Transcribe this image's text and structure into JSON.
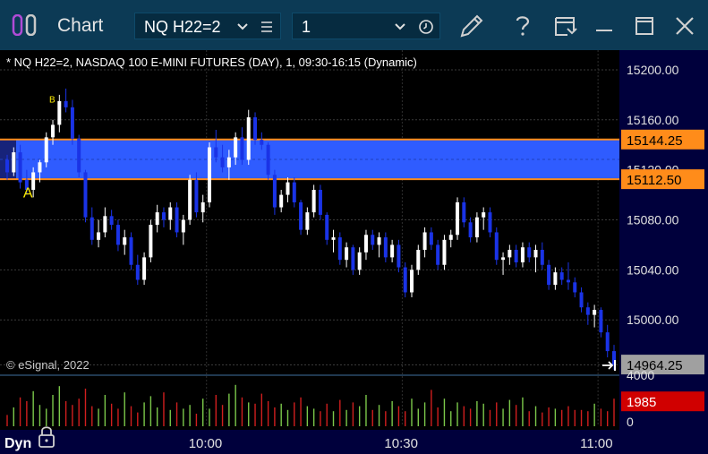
{
  "window": {
    "title": "Chart",
    "symbol": "NQ H22=2",
    "interval": "1",
    "icons": [
      "app-logo-icon",
      "chevron-down-icon",
      "menu-lines-icon",
      "clock-icon",
      "pencil-icon",
      "help-icon",
      "save-template-icon",
      "maximize-icon",
      "close-icon"
    ]
  },
  "colors": {
    "titlebar": "#0c3a55",
    "axis_panel": "#00003c",
    "up_candle": "#ffffff",
    "down_candle": "#1a33e6",
    "band_fill": "#2f5cff",
    "band_border": "#ff8c1a",
    "vol_up": "#7cc84a",
    "vol_down": "#d01e1e",
    "last_price_tag": "#a0a0a0",
    "volume_tag": "#d00000"
  },
  "chart_data": {
    "type": "candlestick",
    "title": "* NQ H22=2, NASDAQ 100 E-MINI FUTURES (DAY), 1, 09:30-16:15 (Dynamic)",
    "copyright": "© eSignal, 2022",
    "y_axis": {
      "range": [
        14950,
        15210
      ],
      "ticks": [
        "15200.00",
        "15160.00",
        "15120.00",
        "15080.00",
        "15040.00",
        "15000.00"
      ],
      "tick_values": [
        15200,
        15160,
        15120,
        15080,
        15040,
        15000
      ]
    },
    "band": {
      "upper": 15144.25,
      "lower": 15112.5,
      "upper_label": "15144.25",
      "lower_label": "15112.50"
    },
    "last_price": {
      "value": 14964.25,
      "label": "14964.25"
    },
    "markers": [
      {
        "label": "B",
        "price": 15174,
        "bar": 7
      },
      {
        "label": "A",
        "price": 15108,
        "bar": 3
      }
    ],
    "x_axis": {
      "ticks": [
        "10:00",
        "10:30",
        "11:00"
      ],
      "tick_bars": [
        30,
        60,
        90
      ],
      "label_mode": "Dyn"
    },
    "volume": {
      "ticks": [
        "4000",
        "0"
      ],
      "range": [
        0,
        4000
      ],
      "last": 1985,
      "last_label": "1985",
      "values": [
        900,
        1500,
        2300,
        2000,
        2800,
        1700,
        1400,
        2500,
        3200,
        2000,
        1700,
        2200,
        3000,
        1600,
        1400,
        2500,
        1800,
        1400,
        2700,
        1600,
        1100,
        1900,
        2400,
        1500,
        2700,
        1300,
        1900,
        1400,
        1700,
        1000,
        2200,
        1400,
        2500,
        1700,
        2600,
        3300,
        2300,
        1900,
        1800,
        2600,
        2000,
        1500,
        1800,
        1300,
        1900,
        2300,
        1600,
        1400,
        1200,
        1800,
        1200,
        2100,
        1300,
        1900,
        1600,
        2500,
        1300,
        1700,
        1200,
        2000,
        1600,
        1200,
        2200,
        1400,
        1900,
        2900,
        1500,
        2200,
        1200,
        1900,
        1600,
        1400,
        2000,
        1800,
        1300,
        1900,
        1400,
        2100,
        1700,
        2300,
        1200,
        1600,
        1100,
        1500,
        1400,
        1300,
        1600,
        1300,
        1300,
        1200,
        1800,
        1400,
        1200,
        2200,
        1300,
        1700,
        1300,
        1200,
        2100,
        1500,
        1400,
        1000,
        1600,
        1100,
        1300,
        1700,
        1200,
        1400,
        2000,
        1985
      ]
    },
    "candles": [
      [
        15128,
        15132,
        15112,
        15118
      ],
      [
        15118,
        15138,
        15115,
        15134
      ],
      [
        15134,
        15140,
        15105,
        15110
      ],
      [
        15112,
        15120,
        15100,
        15104
      ],
      [
        15104,
        15122,
        15098,
        15118
      ],
      [
        15118,
        15128,
        15110,
        15126
      ],
      [
        15126,
        15150,
        15122,
        15146
      ],
      [
        15146,
        15160,
        15140,
        15156
      ],
      [
        15156,
        15180,
        15150,
        15175
      ],
      [
        15175,
        15185,
        15166,
        15170
      ],
      [
        15170,
        15176,
        15140,
        15145
      ],
      [
        15145,
        15148,
        15114,
        15118
      ],
      [
        15118,
        15120,
        15078,
        15082
      ],
      [
        15082,
        15090,
        15060,
        15064
      ],
      [
        15064,
        15080,
        15058,
        15070
      ],
      [
        15070,
        15090,
        15066,
        15083
      ],
      [
        15083,
        15088,
        15072,
        15076
      ],
      [
        15076,
        15080,
        15055,
        15060
      ],
      [
        15060,
        15072,
        15052,
        15066
      ],
      [
        15066,
        15070,
        15040,
        15044
      ],
      [
        15044,
        15052,
        15028,
        15032
      ],
      [
        15032,
        15054,
        15028,
        15050
      ],
      [
        15050,
        15080,
        15046,
        15076
      ],
      [
        15076,
        15092,
        15070,
        15086
      ],
      [
        15086,
        15090,
        15074,
        15080
      ],
      [
        15080,
        15094,
        15072,
        15090
      ],
      [
        15090,
        15094,
        15066,
        15070
      ],
      [
        15070,
        15084,
        15060,
        15080
      ],
      [
        15080,
        15116,
        15076,
        15112
      ],
      [
        15112,
        15118,
        15082,
        15086
      ],
      [
        15086,
        15100,
        15078,
        15094
      ],
      [
        15094,
        15142,
        15090,
        15138
      ],
      [
        15138,
        15152,
        15126,
        15130
      ],
      [
        15130,
        15140,
        15118,
        15122
      ],
      [
        15122,
        15136,
        15112,
        15130
      ],
      [
        15130,
        15150,
        15124,
        15146
      ],
      [
        15146,
        15154,
        15124,
        15128
      ],
      [
        15128,
        15168,
        15124,
        15162
      ],
      [
        15162,
        15166,
        15140,
        15144
      ],
      [
        15144,
        15150,
        15136,
        15140
      ],
      [
        15140,
        15142,
        15112,
        15116
      ],
      [
        15116,
        15120,
        15084,
        15090
      ],
      [
        15090,
        15104,
        15086,
        15100
      ],
      [
        15100,
        15114,
        15094,
        15110
      ],
      [
        15110,
        15114,
        15090,
        15094
      ],
      [
        15094,
        15096,
        15068,
        15072
      ],
      [
        15072,
        15090,
        15068,
        15086
      ],
      [
        15086,
        15108,
        15082,
        15104
      ],
      [
        15104,
        15108,
        15080,
        15084
      ],
      [
        15084,
        15086,
        15060,
        15064
      ],
      [
        15064,
        15072,
        15054,
        15066
      ],
      [
        15066,
        15070,
        15044,
        15048
      ],
      [
        15048,
        15062,
        15042,
        15058
      ],
      [
        15058,
        15060,
        15036,
        15040
      ],
      [
        15040,
        15058,
        15036,
        15054
      ],
      [
        15054,
        15072,
        15048,
        15068
      ],
      [
        15068,
        15072,
        15056,
        15060
      ],
      [
        15060,
        15070,
        15050,
        15066
      ],
      [
        15066,
        15070,
        15046,
        15050
      ],
      [
        15050,
        15064,
        15046,
        15060
      ],
      [
        15060,
        15064,
        15038,
        15042
      ],
      [
        15042,
        15046,
        15018,
        15022
      ],
      [
        15022,
        15044,
        15018,
        15040
      ],
      [
        15040,
        15060,
        15036,
        15056
      ],
      [
        15056,
        15074,
        15050,
        15070
      ],
      [
        15070,
        15074,
        15056,
        15060
      ],
      [
        15060,
        15064,
        15040,
        15044
      ],
      [
        15044,
        15068,
        15040,
        15064
      ],
      [
        15064,
        15072,
        15058,
        15068
      ],
      [
        15068,
        15098,
        15064,
        15094
      ],
      [
        15094,
        15098,
        15074,
        15078
      ],
      [
        15078,
        15082,
        15062,
        15066
      ],
      [
        15066,
        15086,
        15062,
        15082
      ],
      [
        15082,
        15090,
        15072,
        15086
      ],
      [
        15086,
        15090,
        15066,
        15070
      ],
      [
        15070,
        15074,
        15044,
        15048
      ],
      [
        15048,
        15054,
        15036,
        15050
      ],
      [
        15050,
        15060,
        15044,
        15056
      ],
      [
        15056,
        15060,
        15042,
        15046
      ],
      [
        15046,
        15062,
        15042,
        15058
      ],
      [
        15058,
        15062,
        15046,
        15050
      ],
      [
        15050,
        15060,
        15038,
        15056
      ],
      [
        15056,
        15062,
        15040,
        15044
      ],
      [
        15044,
        15048,
        15024,
        15028
      ],
      [
        15028,
        15042,
        15024,
        15038
      ],
      [
        15038,
        15042,
        15028,
        15032
      ],
      [
        15032,
        15046,
        15024,
        15030
      ],
      [
        15030,
        15034,
        15018,
        15022
      ],
      [
        15022,
        15026,
        15006,
        15010
      ],
      [
        15010,
        15014,
        14996,
        15004
      ],
      [
        15004,
        15012,
        14994,
        15008
      ],
      [
        15008,
        15010,
        14986,
        14990
      ],
      [
        14990,
        14996,
        14970,
        14975
      ],
      [
        14975,
        14980,
        14960,
        14964.25
      ]
    ]
  }
}
